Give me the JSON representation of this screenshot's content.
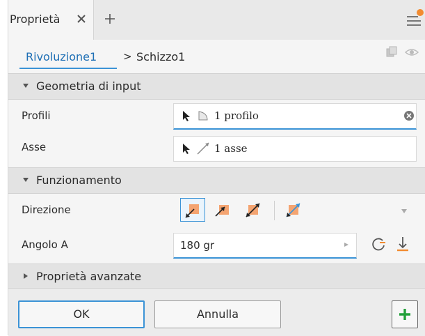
{
  "tab": {
    "label": "Proprietà"
  },
  "breadcrumb": {
    "link": "Rivoluzione1",
    "separator": ">",
    "current": "Schizzo1"
  },
  "sections": {
    "input": {
      "title": "Geometria di input"
    },
    "behavior": {
      "title": "Funzionamento"
    },
    "advanced": {
      "title": "Proprietà avanzate"
    }
  },
  "fields": {
    "profiles": {
      "label": "Profili",
      "value": "1 profilo"
    },
    "axis": {
      "label": "Asse",
      "value": "1 asse"
    },
    "direction": {
      "label": "Direzione"
    },
    "angle": {
      "label": "Angolo A",
      "value": "180 gr"
    }
  },
  "buttons": {
    "ok": "OK",
    "cancel": "Annulla"
  },
  "colors": {
    "accent": "#3b93d6",
    "link": "#1e6fb5",
    "notify": "#f28b30",
    "add": "#22a03a",
    "direction_fill": "#f4a471"
  }
}
